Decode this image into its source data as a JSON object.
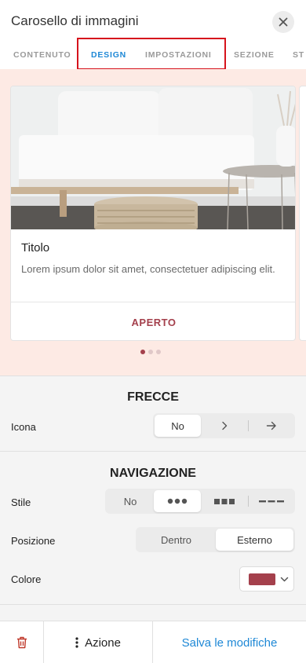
{
  "header": {
    "title": "Carosello di immagini",
    "close_icon": "close-icon"
  },
  "tabs": [
    {
      "label": "CONTENUTO",
      "active": false
    },
    {
      "label": "DESIGN",
      "active": true
    },
    {
      "label": "IMPOSTAZIONI",
      "active": false
    },
    {
      "label": "SEZIONE",
      "active": false
    },
    {
      "label": "ST",
      "active": false
    }
  ],
  "preview": {
    "card": {
      "title": "Titolo",
      "text": "Lorem ipsum dolor sit amet, consectetuer adipiscing elit.",
      "link_label": "APERTO"
    },
    "dots_count": 3,
    "active_dot": 0
  },
  "arrows": {
    "section_title": "FRECCE",
    "icon_label": "Icona",
    "options": [
      {
        "label": "No",
        "icon": null
      },
      {
        "label": "",
        "icon": "chevron-right-icon"
      },
      {
        "label": "",
        "icon": "arrow-right-icon"
      }
    ],
    "selected_index": 0
  },
  "navigation": {
    "section_title": "NAVIGAZIONE",
    "style_label": "Stile",
    "style_options": [
      {
        "label": "No",
        "icon": null
      },
      {
        "label": "",
        "icon": "dots-icon"
      },
      {
        "label": "",
        "icon": "squares-icon"
      },
      {
        "label": "",
        "icon": "dashes-icon"
      }
    ],
    "style_selected_index": 1,
    "position_label": "Posizione",
    "position_options": [
      "Dentro",
      "Esterno"
    ],
    "position_selected_index": 1,
    "color_label": "Colore",
    "color_value": "#a4404c"
  },
  "footer": {
    "delete_icon": "trash-icon",
    "action_icon": "more-vertical-icon",
    "action_label": "Azione",
    "save_label": "Salva le modifiche"
  },
  "colors": {
    "accent": "#1e88d6",
    "brand": "#a4404c",
    "highlight": "#d6131c",
    "preview_bg": "#fdeae4"
  }
}
